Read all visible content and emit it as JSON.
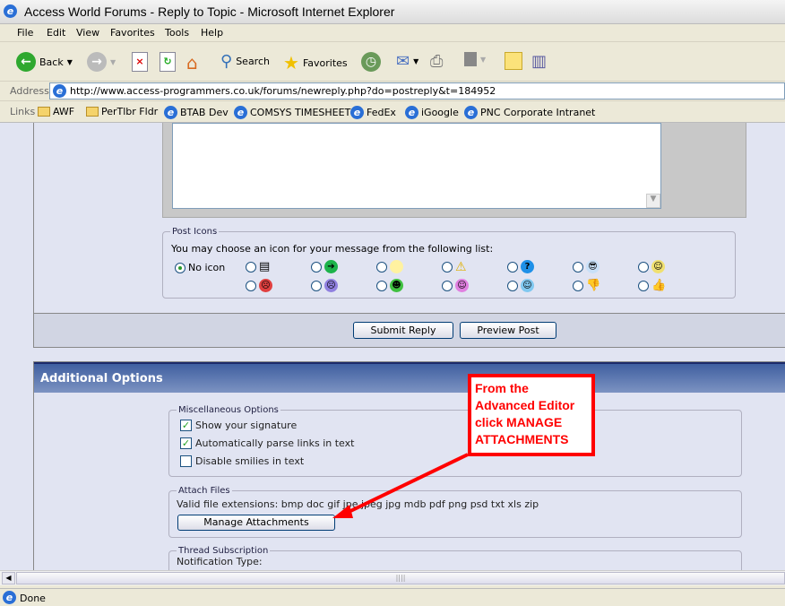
{
  "window": {
    "title": "Access World Forums - Reply to Topic - Microsoft Internet Explorer"
  },
  "menu": [
    "File",
    "Edit",
    "View",
    "Favorites",
    "Tools",
    "Help"
  ],
  "toolbar": {
    "back": "Back",
    "search": "Search",
    "favorites": "Favorites"
  },
  "address": {
    "label": "Address",
    "url": "http://www.access-programmers.co.uk/forums/newreply.php?do=postreply&t=184952"
  },
  "links": {
    "label": "Links",
    "items": [
      "AWF",
      "PerTlbr Fldr",
      "BTAB Dev",
      "COMSYS TIMESHEET",
      "FedEx",
      "iGoogle",
      "PNC Corporate Intranet"
    ]
  },
  "post_icons": {
    "legend": "Post Icons",
    "prompt": "You may choose an icon for your message from the following list:",
    "no_icon": "No icon"
  },
  "buttons": {
    "submit": "Submit Reply",
    "preview": "Preview Post"
  },
  "additional": {
    "title": "Additional Options",
    "misc": {
      "legend": "Miscellaneous Options",
      "options": [
        {
          "label": "Show your signature",
          "checked": true
        },
        {
          "label": "Automatically parse links in text",
          "checked": true
        },
        {
          "label": "Disable smilies in text",
          "checked": false
        }
      ]
    },
    "attach": {
      "legend": "Attach Files",
      "extensions": "Valid file extensions: bmp doc gif jpe jpeg jpg mdb pdf png psd txt xls zip",
      "button": "Manage Attachments"
    },
    "subscription": {
      "legend": "Thread Subscription",
      "notification": "Notification Type:"
    }
  },
  "callout": {
    "line1": "From the",
    "line2": "Advanced Editor",
    "line3": "click MANAGE",
    "line4": "ATTACHMENTS",
    "color": "#ff0000"
  },
  "status": {
    "text": "Done"
  }
}
